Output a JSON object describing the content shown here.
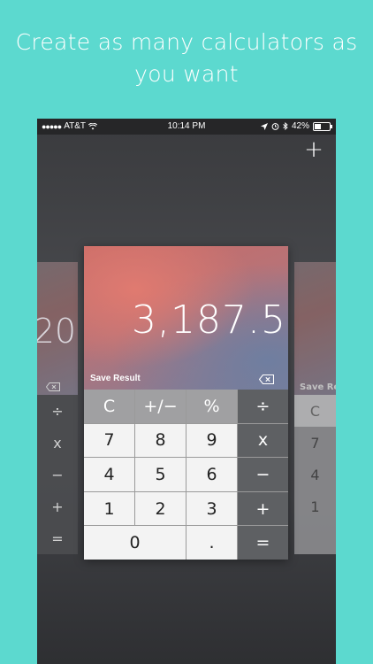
{
  "headline": "Create as many calculators as you want",
  "statusbar": {
    "carrier": "AT&T",
    "time": "10:14 PM",
    "battery": "42%",
    "battery_level": 0.42
  },
  "icons": {
    "add": "plus-icon",
    "backspace": "backspace-icon",
    "wifi": "wifi-icon",
    "location": "location-arrow-icon",
    "alarm": "alarm-icon",
    "bluetooth": "bluetooth-icon",
    "battery": "battery-icon"
  },
  "main": {
    "result": "3,187.5",
    "save_label": "Save Result",
    "keys": {
      "clear": "C",
      "sign": "+/−",
      "percent": "%",
      "divide": "÷",
      "seven": "7",
      "eight": "8",
      "nine": "9",
      "multiply": "x",
      "four": "4",
      "five": "5",
      "six": "6",
      "minus": "−",
      "one": "1",
      "two": "2",
      "three": "3",
      "plus": "+",
      "zero": "0",
      "decimal": ".",
      "equals": "="
    }
  },
  "left_card": {
    "result": "20",
    "keys": {
      "divide": "÷",
      "multiply": "x",
      "minus": "−",
      "plus": "+",
      "equals": "="
    }
  },
  "right_card": {
    "save_label": "Save Re",
    "keys": {
      "clear": "C",
      "seven": "7",
      "four": "4",
      "one": "1"
    }
  },
  "colors": {
    "background": "#5cd9cf",
    "function_key": "#a0a0a2",
    "number_key": "#f3f3f3",
    "operator_key": "#5e6063"
  }
}
